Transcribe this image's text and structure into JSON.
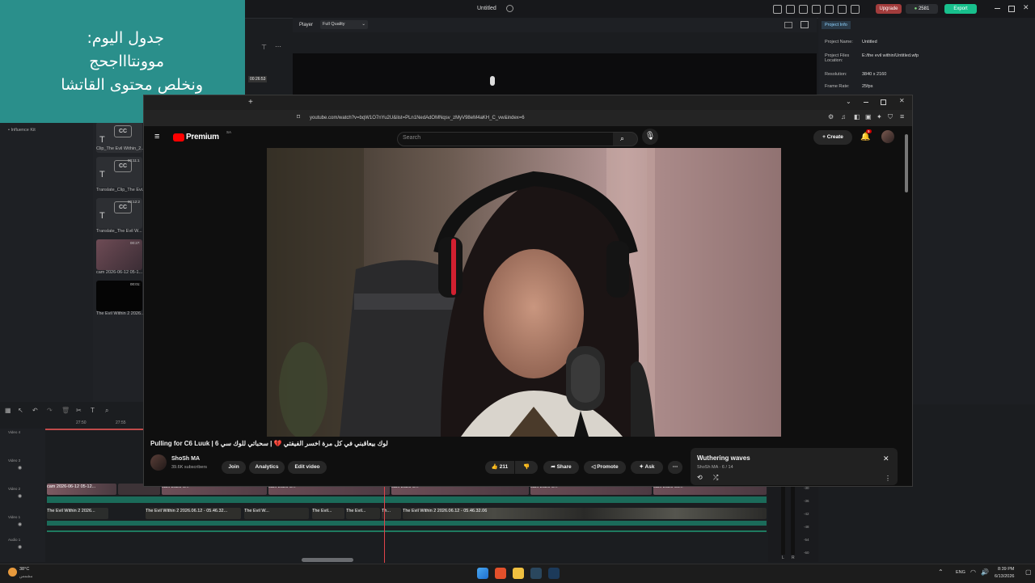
{
  "editor": {
    "title": "Untitled",
    "upgrade_label": "Upgrade",
    "credits": "2581",
    "export_label": "Export",
    "player_label": "Player",
    "quality": "Full Quality",
    "timecode": "00:26:53",
    "influence_kit": "Influence Kit",
    "media": [
      {
        "caption": "Clip_The Evil Within_2...",
        "duration": ""
      },
      {
        "caption": "Translate_Clip_The Evi...",
        "duration": "00:11:1"
      },
      {
        "caption": "Translate_The Evil W...",
        "duration": "00:12:2"
      },
      {
        "caption": "cam 2026-06-12 05-1...",
        "duration": "00:27:"
      },
      {
        "caption": "The Evil Within 2 2026...",
        "duration": "00:01:"
      }
    ],
    "ruler": [
      "27:50",
      "27:55"
    ],
    "tracks": [
      "Video 4",
      "Video 3",
      "Video 2",
      "Video 1",
      "Audio 1"
    ],
    "clips_v2": [
      "cam 2026-06-12 05-12...",
      "cam 2026-0...",
      "cam 2026-0...",
      "cam 2026-0...",
      "cam 2026-0...",
      "cam 2026-06..."
    ],
    "clips_v1": [
      "The Evil Within 2 2026...",
      "The Evil Within 2 2026.06.12 - 05.46.32...",
      "The Evil W...",
      "The Evil...",
      "The Evil...",
      "Th...",
      "The Evil Within 2 2026.06.12 - 05.46.32.06"
    ],
    "meter_ticks": [
      "-30",
      "-36",
      "-42",
      "-48",
      "-54",
      "-60"
    ],
    "meter_lr": [
      "L",
      "R"
    ],
    "project_info": {
      "tab": "Project Info",
      "rows": [
        {
          "label": "Project Name:",
          "value": "Untitled"
        },
        {
          "label": "Project Files Location:",
          "value": "E:/the evil within/Untitled.wfp"
        },
        {
          "label": "Resolution:",
          "value": "3840 x 2160"
        },
        {
          "label": "Frame Rate:",
          "value": "25fps"
        }
      ]
    }
  },
  "note": {
    "line1": "جدول اليوم:",
    "line2": "موونتاااجحج",
    "line3": "ونخلص محتوى القاتشا"
  },
  "browser": {
    "url": "youtube.com/watch?v=bqW1O7nYu2U&list=PLn1NedAdOMNqsv_zMyV98eM4aKH_C_vw&index=6",
    "premium_badge": "Premium",
    "premium_region": "SA",
    "search_placeholder": "Search",
    "create_label": "Create",
    "notif_count": "9",
    "video_title": "Pulling for C6 Luuk | لوك بيعاقبني في كل مرة اخسر الفيفتي 💔 | سحباتي للوك سي 6",
    "channel": "ShoSh MA",
    "subscribers": "39.6K subscribers",
    "join": "Join",
    "analytics": "Analytics",
    "edit_video": "Edit video",
    "likes": "211",
    "share": "Share",
    "promote": "Promote",
    "ask": "Ask",
    "mini_title": "Wuthering waves",
    "mini_sub": "ShoSh MA · 6 / 14"
  },
  "taskbar": {
    "temp": "38°C",
    "weather": "مشمس",
    "lang": "ENG",
    "time": "8:39 PM",
    "date": "6/13/2026"
  }
}
